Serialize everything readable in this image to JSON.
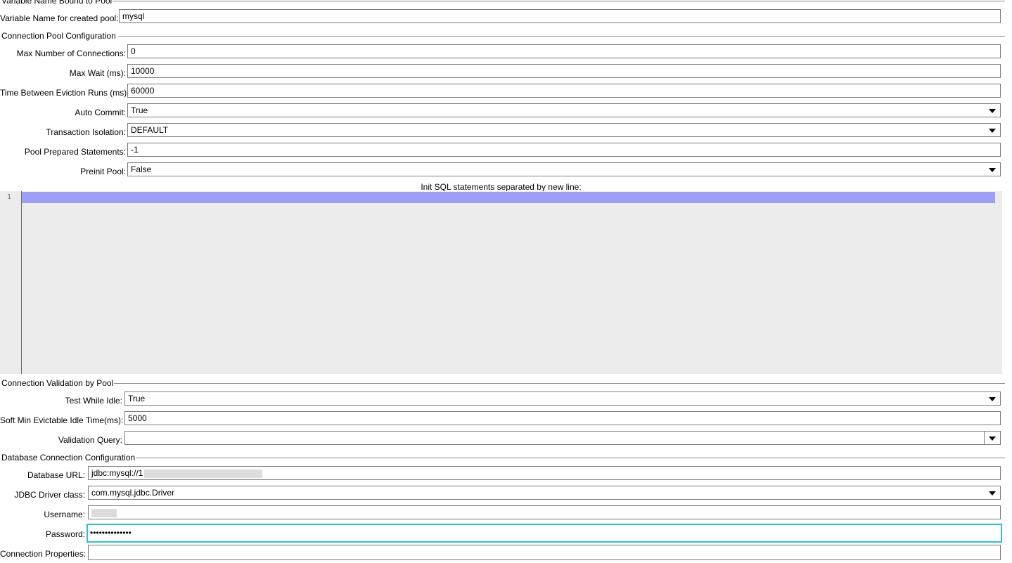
{
  "sections": {
    "variable": "Variable Name Bound to Pool",
    "pool": "Connection Pool Configuration",
    "validation": "Connection Validation by Pool",
    "database": "Database Connection Configuration"
  },
  "variable": {
    "label": "Variable Name for created pool:",
    "value": "mysql"
  },
  "pool": {
    "max_connections": {
      "label": "Max Number of Connections:",
      "value": "0"
    },
    "max_wait": {
      "label": "Max Wait (ms):",
      "value": "10000"
    },
    "eviction": {
      "label": "Time Between Eviction Runs (ms):",
      "value": "60000"
    },
    "auto_commit": {
      "label": "Auto Commit:",
      "value": "True"
    },
    "isolation": {
      "label": "Transaction Isolation:",
      "value": "DEFAULT"
    },
    "prepared": {
      "label": "Pool Prepared Statements:",
      "value": "-1"
    },
    "preinit": {
      "label": "Preinit Pool:",
      "value": "False"
    },
    "init_sql_title": "Init SQL statements separated by new line:",
    "init_sql_line": "1"
  },
  "validation": {
    "test_idle": {
      "label": "Test While Idle:",
      "value": "True"
    },
    "soft_min": {
      "label": "Soft Min Evictable Idle Time(ms):",
      "value": "5000"
    },
    "query": {
      "label": "Validation Query:",
      "value": ""
    }
  },
  "database": {
    "url": {
      "label": "Database URL:",
      "value": "jdbc:mysql://1"
    },
    "driver": {
      "label": "JDBC Driver class:",
      "value": "com.mysql.jdbc.Driver"
    },
    "username": {
      "label": "Username:"
    },
    "password": {
      "label": "Password:",
      "value": "••••••••••••••"
    },
    "properties": {
      "label": "Connection Properties:",
      "value": ""
    }
  },
  "colors": {
    "focus_border": "#2ec0d2",
    "line_highlight": "#9e9ef5",
    "editor_bg": "#ececec"
  }
}
